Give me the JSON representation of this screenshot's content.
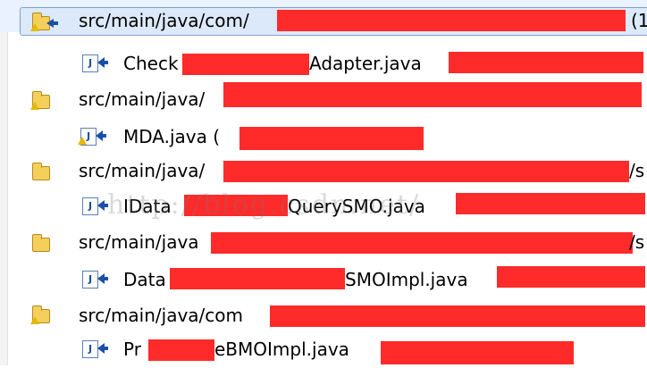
{
  "watermark_text": "http://blog.csdn.net/",
  "colors": {
    "redaction": "#ff2a2a",
    "selection": "#dce9fb",
    "selection_border": "#7da2ce"
  },
  "rows": [
    {
      "type": "package",
      "label": "src/main/java/com/",
      "suffix": "(1",
      "warning": false,
      "selected": true
    },
    {
      "type": "file",
      "label_a": "Check",
      "label_b": "Adapter.java",
      "warning": false
    },
    {
      "type": "package",
      "label": "src/main/java/",
      "warning": true
    },
    {
      "type": "file",
      "label_a": "MDA.java (",
      "warning": true
    },
    {
      "type": "package",
      "label": "src/main/java/",
      "suffix": "/s",
      "warning": false
    },
    {
      "type": "file",
      "label_a": "IData",
      "label_b": "QuerySMO.java",
      "warning": false
    },
    {
      "type": "package",
      "label": "src/main/java",
      "suffix": "/s",
      "warning": false
    },
    {
      "type": "file",
      "label_a": "Data",
      "label_b": "SMOImpl.java",
      "warning": false
    },
    {
      "type": "package",
      "label": "src/main/java/com",
      "warning": true
    },
    {
      "type": "file",
      "label_a": "Pr",
      "label_b": "eBMOImpl.java",
      "warning": false
    }
  ]
}
